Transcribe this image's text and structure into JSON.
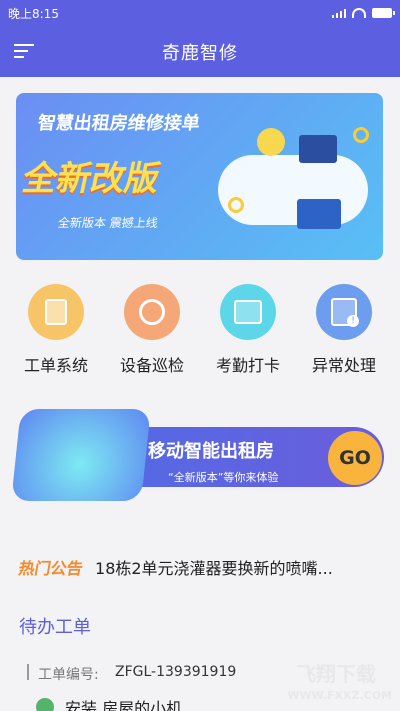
{
  "status": {
    "time": "晚上8:15"
  },
  "app": {
    "title": "奇鹿智修"
  },
  "banner": {
    "top_text": "智慧出租房维修接单",
    "headline": "全新改版",
    "subline": "全新版本 震撼上线"
  },
  "menu": {
    "items": [
      {
        "label": "工单系统",
        "icon": "document-icon"
      },
      {
        "label": "设备巡检",
        "icon": "inspection-icon"
      },
      {
        "label": "考勤打卡",
        "icon": "check-in-icon"
      },
      {
        "label": "异常处理",
        "icon": "warning-icon"
      }
    ]
  },
  "promo": {
    "title": "移动智能出租房",
    "subtitle": "“全新版本”等你来体验",
    "go": "GO"
  },
  "notice": {
    "tag": "热门公告",
    "text": "18栋2单元浇灌器要换新的喷嘴..."
  },
  "todo": {
    "title": "待办工单",
    "order_label": "工单编号:",
    "order_value": "ZFGL-139391919",
    "task_name": "安装 房屋的小机"
  },
  "watermark": {
    "brand": "飞翔下载",
    "url": "WWW.FXXZ.COM"
  }
}
